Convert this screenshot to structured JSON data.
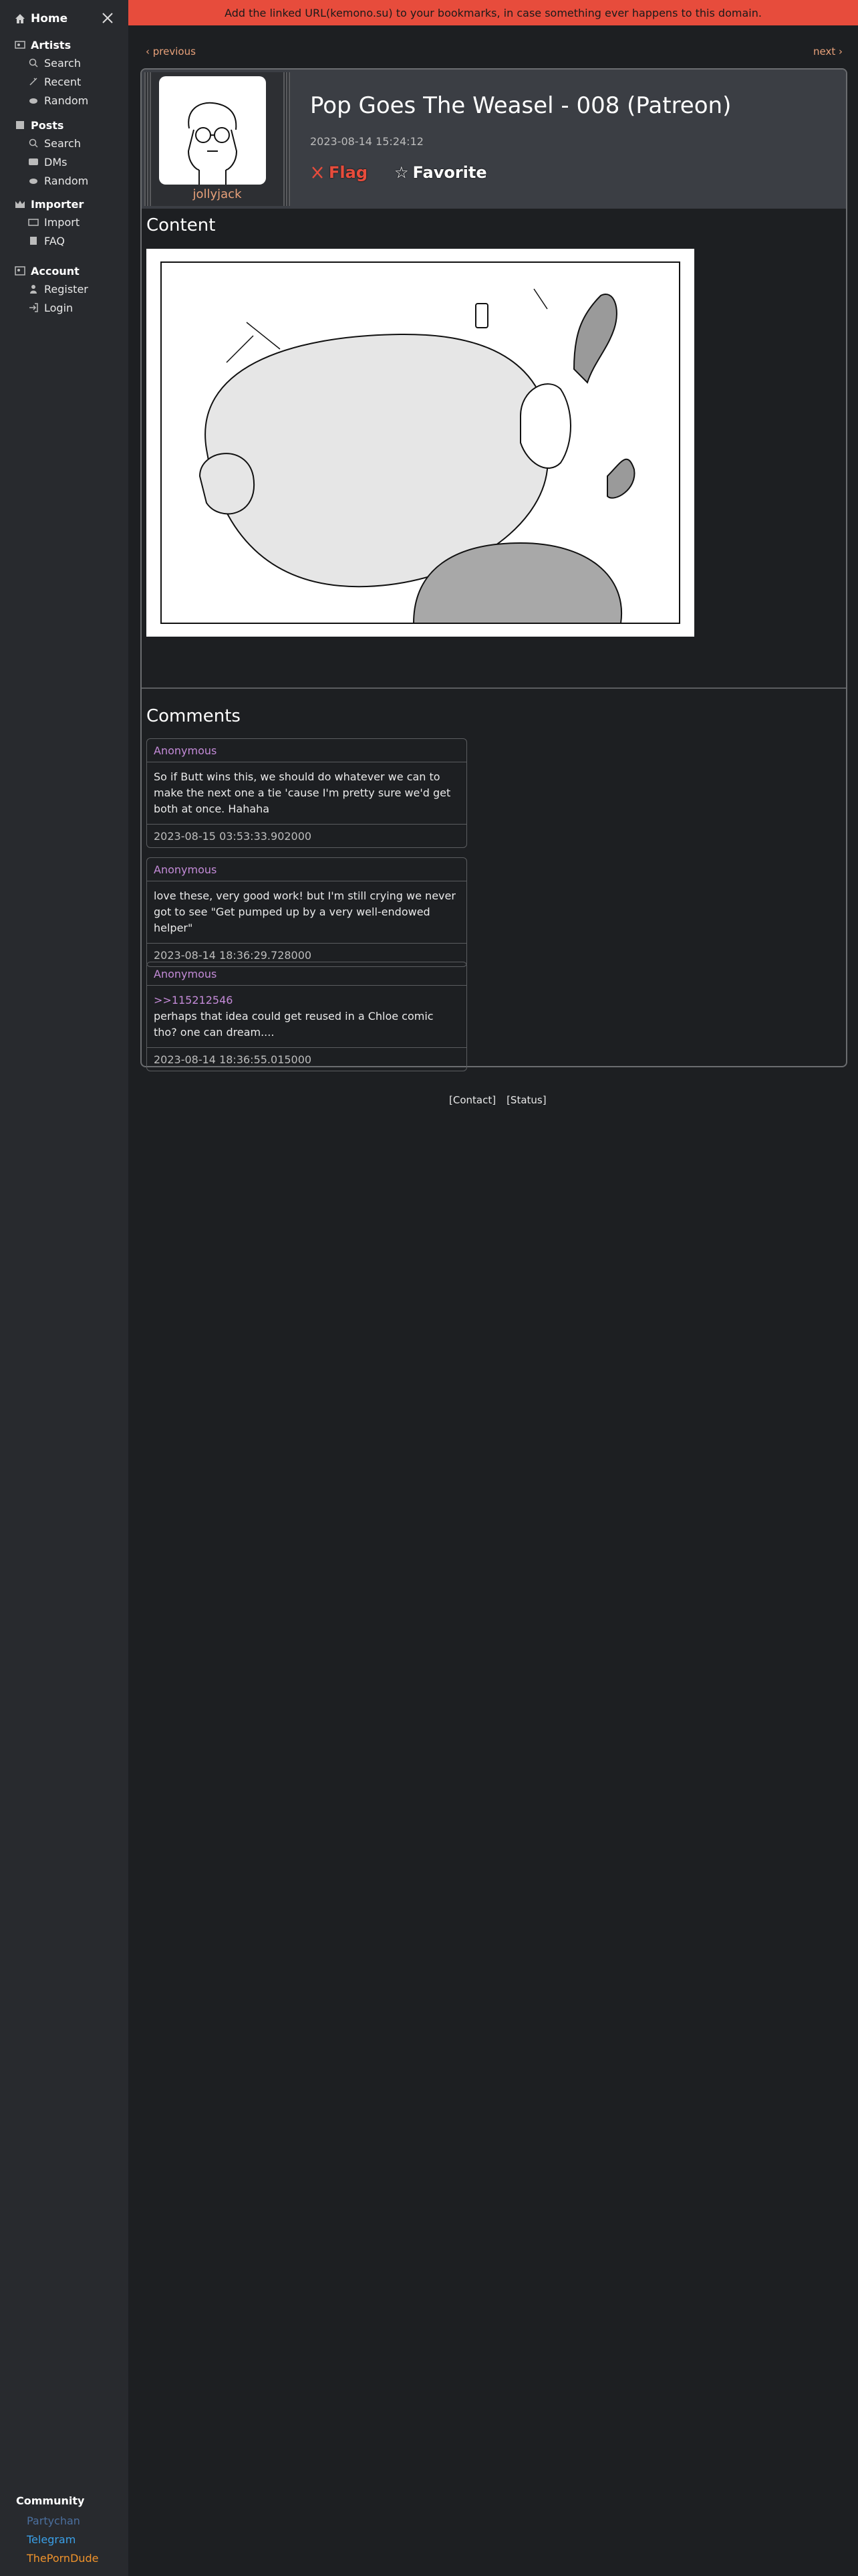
{
  "sidebar": {
    "home": "Home",
    "sections": [
      {
        "title": "Artists",
        "icon": "artists-icon",
        "items": [
          {
            "label": "Search",
            "icon": "search-icon"
          },
          {
            "label": "Recent",
            "icon": "recent-icon"
          },
          {
            "label": "Random",
            "icon": "random-icon"
          }
        ]
      },
      {
        "title": "Posts",
        "icon": "posts-icon",
        "items": [
          {
            "label": "Search",
            "icon": "search-icon"
          },
          {
            "label": "DMs",
            "icon": "dms-icon"
          },
          {
            "label": "Random",
            "icon": "random-icon"
          }
        ]
      },
      {
        "title": "Importer",
        "icon": "importer-icon",
        "items": [
          {
            "label": "Import",
            "icon": "import-icon"
          },
          {
            "label": "FAQ",
            "icon": "faq-icon"
          }
        ]
      },
      {
        "title": "Account",
        "icon": "account-icon",
        "items": [
          {
            "label": "Register",
            "icon": "register-icon"
          },
          {
            "label": "Login",
            "icon": "login-icon"
          }
        ]
      }
    ],
    "community": {
      "title": "Community",
      "links": [
        {
          "label": "Partychan",
          "color": "#4b6f9e"
        },
        {
          "label": "Telegram",
          "color": "#3aa0e8"
        },
        {
          "label": "ThePornDude",
          "color": "#f0932b"
        }
      ]
    }
  },
  "banner": "Add the linked URL(kemono.su) to your bookmarks, in case something ever happens to this domain.",
  "pager": {
    "previous": "‹ previous",
    "next": "next ›"
  },
  "post": {
    "artist": "jollyjack",
    "title": "Pop Goes The Weasel - 008 (Patreon)",
    "date": "2023-08-14 15:24:12",
    "flag": "Flag",
    "favorite": "Favorite"
  },
  "content": {
    "title": "Content"
  },
  "comments": {
    "title": "Comments",
    "items": [
      {
        "author": "Anonymous",
        "body": "So if Butt wins this, we should do whatever we can to make the next one a tie 'cause I'm pretty sure we'd get both at once. Hahaha",
        "ref": "",
        "time": "2023-08-15 03:53:33.902000"
      },
      {
        "author": "Anonymous",
        "body": "love these, very good work! but I'm still crying we never got to see \"Get pumped up by a very well-endowed helper\"",
        "ref": "",
        "time": "2023-08-14 18:36:29.728000"
      },
      {
        "author": "Anonymous",
        "body": "perhaps that idea could get reused in a Chloe comic tho? one can dream....",
        "ref": ">>115212546",
        "time": "2023-08-14 18:36:55.015000"
      }
    ]
  },
  "footer": {
    "contact": "[Contact]",
    "status": "[Status]"
  },
  "colors": {
    "accent": "#e8a17a",
    "banner": "#e74c3c",
    "commentAuthor": "#c48bd8"
  }
}
